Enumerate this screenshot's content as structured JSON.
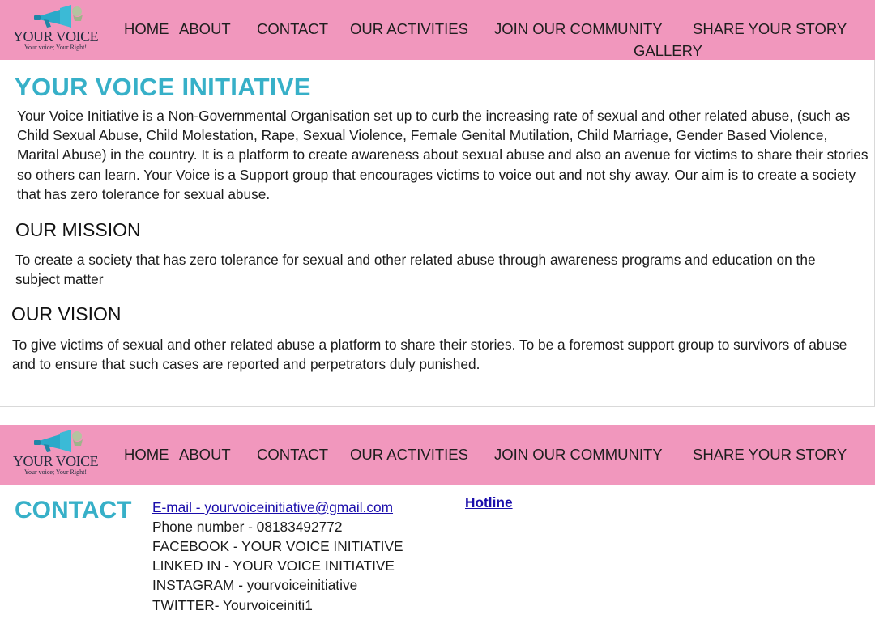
{
  "site": {
    "logo_title": "YOUR VOICE",
    "logo_tagline": "Your voice; Your Right!",
    "colors": {
      "nav_bg": "#f197bd",
      "accent": "#37b0c8",
      "link": "#1a0dab"
    }
  },
  "nav": {
    "home": "HOME",
    "about": "ABOUT",
    "contact": "CONTACT",
    "activities": "OUR ACTIVITIES",
    "community": "JOIN OUR COMMUNITY",
    "story": "SHARE YOUR STORY",
    "gallery": "GALLERY"
  },
  "about": {
    "title": "YOUR VOICE INITIATIVE",
    "intro": "Your Voice Initiative is a Non-Governmental Organisation set up to curb the increasing rate of sexual and other related abuse, (such as Child Sexual Abuse, Child Molestation, Rape, Sexual Violence, Female Genital Mutilation, Child Marriage, Gender Based Violence, Marital Abuse) in the country. It is a platform to create awareness about sexual abuse and also an avenue for victims to share their stories so others can learn. Your Voice is a Support group that  encourages victims to voice out and not shy away. Our aim is to create a society that has zero tolerance for sexual abuse.",
    "mission_heading": "OUR MISSION",
    "mission_text": "To create a society that has zero tolerance for sexual and other related abuse through awareness programs and education on the subject matter",
    "vision_heading": "OUR VISION",
    "vision_text": "To give victims of sexual and other related abuse a platform to share their stories. To be a foremost support group to survivors of abuse and to ensure that such cases are reported and perpetrators duly punished."
  },
  "contact": {
    "title": "CONTACT",
    "email": "E-mail - yourvoiceinitiative@gmail.com",
    "phone": "Phone number - 08183492772",
    "facebook": "FACEBOOK - YOUR VOICE INITIATIVE",
    "linkedin": "LINKED IN - YOUR VOICE INITIATIVE",
    "instagram": "INSTAGRAM - yourvoiceinitiative",
    "twitter": "TWITTER- Yourvoiceiniti1",
    "hotline": "Hotline"
  },
  "icons": {
    "logo_mark": "megaphone-icon"
  }
}
